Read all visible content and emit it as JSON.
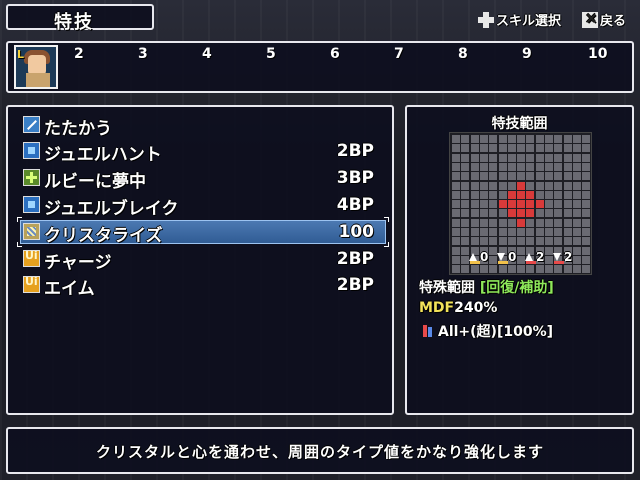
{
  "header": {
    "title": "特技",
    "skill_select_label": "スキル選択",
    "back_label": "戻る"
  },
  "party": {
    "leader_badge": "L",
    "slots": [
      "2",
      "3",
      "4",
      "5",
      "6",
      "7",
      "8",
      "9",
      "10"
    ]
  },
  "skills": [
    {
      "name": "たたかう",
      "cost": "",
      "icon": "sword-icon"
    },
    {
      "name": "ジュエルハント",
      "cost": "2BP",
      "icon": "gem-icon"
    },
    {
      "name": "ルビーに夢中",
      "cost": "3BP",
      "icon": "heal-plus-icon"
    },
    {
      "name": "ジュエルブレイク",
      "cost": "4BP",
      "icon": "gem-icon"
    },
    {
      "name": "クリスタライズ",
      "cost": "100",
      "icon": "crystal-icon",
      "selected": true
    },
    {
      "name": "チャージ",
      "cost": "2BP",
      "icon": "ultimate-icon"
    },
    {
      "name": "エイム",
      "cost": "2BP",
      "icon": "ultimate-icon"
    }
  ],
  "range": {
    "title": "特技範囲",
    "counters": [
      {
        "direction": "up",
        "value": "0",
        "color": "#f2c14a"
      },
      {
        "direction": "down",
        "value": "0",
        "color": "#f2c14a"
      },
      {
        "direction": "up",
        "value": "2",
        "color": "#e84a4a"
      },
      {
        "direction": "down",
        "value": "2",
        "color": "#e84a4a"
      }
    ],
    "special_label": "特殊範囲",
    "special_tag": "[回復/補助]",
    "mdf_label": "MDF",
    "mdf_value": "240%",
    "target_text": "All+(超)[100%]"
  },
  "description": "クリスタルと心を通わせ、周囲のタイプ値をかなり強化します",
  "colors": {
    "accent_green": "#8ee85a",
    "accent_yellow": "#f2e35a",
    "highlight_blue": "#3e6aa3",
    "range_hit": "#d83a3a"
  }
}
